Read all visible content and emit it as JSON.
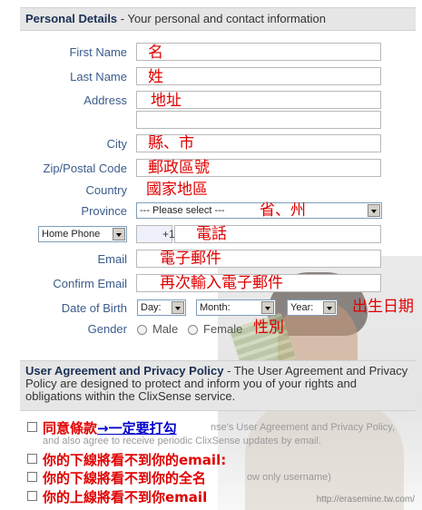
{
  "personal": {
    "header_title": "Personal Details",
    "header_subtitle": " - Your personal and contact information",
    "labels": {
      "first_name": "First Name",
      "last_name": "Last Name",
      "address": "Address",
      "city": "City",
      "zip": "Zip/Postal Code",
      "country": "Country",
      "province": "Province",
      "email": "Email",
      "confirm_email": "Confirm Email",
      "dob": "Date of Birth",
      "gender": "Gender"
    },
    "annotations": {
      "first_name": "名",
      "last_name": "姓",
      "address": "地址",
      "city": "縣、市",
      "zip": "郵政區號",
      "country": "國家地區",
      "province": "省、州",
      "phone": "電話",
      "email": "電子郵件",
      "confirm_email": "再次輸入電子郵件",
      "dob": "出生日期",
      "gender": "性別"
    },
    "country_value": "",
    "province_select": "--- Please select ---",
    "phone_type_select": "Home Phone",
    "phone_prefix": "+1",
    "dob_day": "Day:",
    "dob_month": "Month:",
    "dob_year": "Year:",
    "gender_male": "Male",
    "gender_female": "Female"
  },
  "agreement": {
    "header_title": "User Agreement and Privacy Policy",
    "header_text": " - The User Agreement and Privacy Policy are designed to protect and inform you of your rights and obligations within the ClixSense service.",
    "cb1_annotation": "同意條款",
    "cb1_link": "→一定要打勾",
    "cb1_faint": "nse's User Agreement and Privacy Policy,",
    "cb1_faint2": "and also agree to receive periodic ClixSense updates by email.",
    "cb2_annotation": "你的下線將看不到你的email:",
    "cb3_annotation": "你的下線將看不到你的全名",
    "cb3_faint": "ow only username)",
    "cb4_annotation": "你的上線將看不到你email",
    "watermark": "http://erasemine.tw.com/"
  },
  "colors": {
    "label": "#3b5b8c",
    "annotation": "#e00000",
    "header_bg": "#e6e6e6"
  }
}
